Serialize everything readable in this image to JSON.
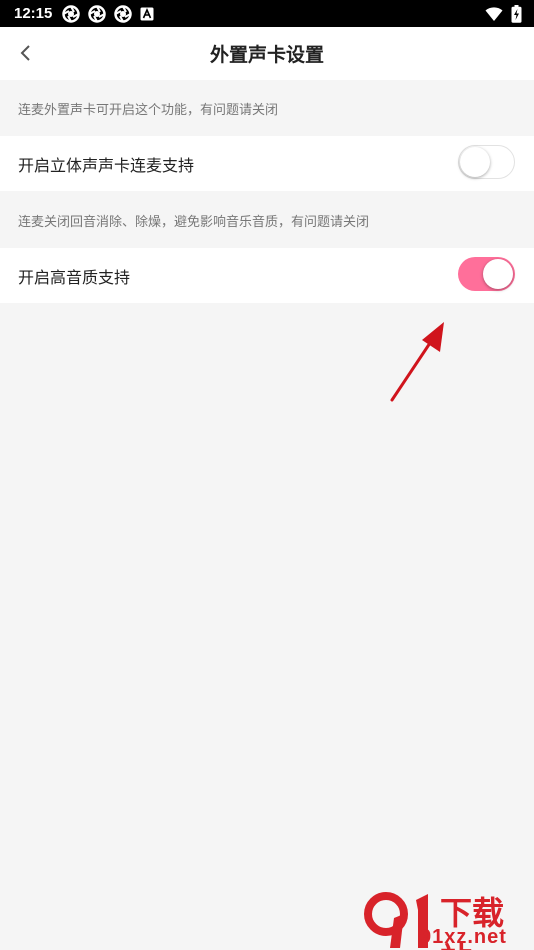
{
  "status_bar": {
    "time": "12:15"
  },
  "header": {
    "title": "外置声卡设置"
  },
  "sections": [
    {
      "hint": "连麦外置声卡可开启这个功能，有问题请关闭",
      "label": "开启立体声声卡连麦支持",
      "enabled": false
    },
    {
      "hint": "连麦关闭回音消除、除燥，避免影响音乐音质，有问题请关闭",
      "label": "开启高音质支持",
      "enabled": true
    }
  ],
  "colors": {
    "toggle_on": "#ff6f9a",
    "annotation_arrow": "#d0141c"
  },
  "watermark": {
    "brand_top": "下载站",
    "brand_bottom": "91xz.net"
  }
}
